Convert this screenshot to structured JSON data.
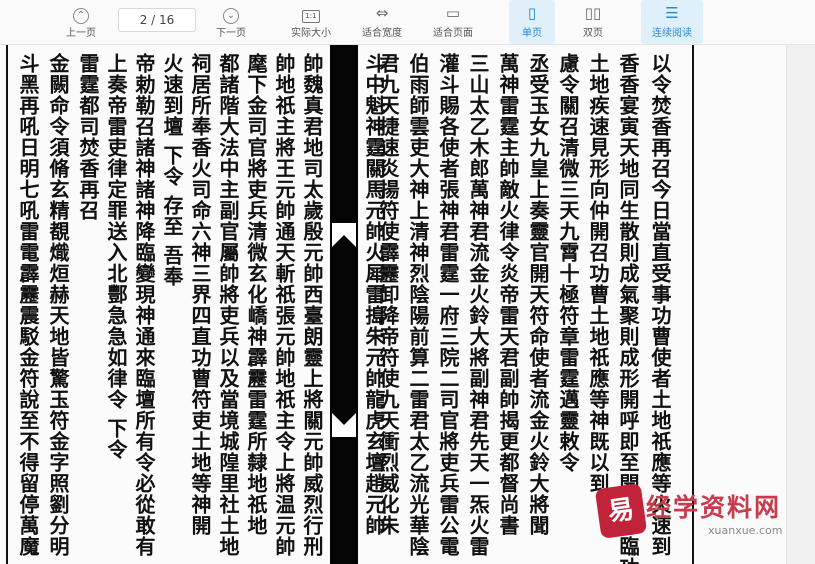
{
  "toolbar": {
    "prev_page": "上一页",
    "page_indicator": "2 / 16",
    "next_page": "下一页",
    "actual_size": "实际大小",
    "actual_size_icon_text": "1:1",
    "fit_width": "适合宽度",
    "fit_page": "适合页面",
    "single_page": "单页",
    "double_page": "双页",
    "continuous": "连续阅读"
  },
  "document": {
    "columns": [
      "以令焚香再召今日當直受事功曹使者土地祇應等火速到",
      "香香宴寅天地同生散則成氣聚則成形開呼即至開召即臨功",
      "土地疾速見形向仲開召功曹土地祇應等神既以到",
      "慮令關召清微三天九霄十極符章雷霆邁靈敕令",
      "丞受玉女九皇上奏靈官開天符命使者流金火鈴大將聞",
      "萬神雷霆主帥敵火律令炎帝雷天君副帥揭更都督尚書",
      "三山太乙木郎萬神君流金火鈴大將副神君先天一炁火雷",
      "灌斗賜各使者張神君雷霆一府三院二司官將吏兵雷公電",
      "伯雨師雲吏大神上清神烈陰陽前算二雷君太乙流光華陰",
      "君九天捷速炎揚符使霹靂卸降帝符使九天衝烈威化朱",
      "斗中魁神霆關馬元帥火犀雷搗朱元帥龍虎玄壇趙元帥",
      "帥魏真君地司太歲殷元帥西臺朗靈上將關元帥威烈行刑",
      "帥地祇主將王元帥通天斬祇張元帥地祇主令上將温元帥",
      "麾下金司官將吏兵清微玄化嶠神霹靂雷霆所隸地祇地",
      "都諸階大法中主副官屬帥將吏兵以及當境城隍里社土地",
      "祠居所奉香火司命六神三界四直功曹符吏土地等神開",
      "火速到壇 下令 存至 吾奉",
      "帝勅勒召諸神諸神降臨變現神通來臨壇所有令必從敢有",
      "上奏帝雷吏律定罪送入北酆急急如律令 下令",
      "雷霆都司焚香再召",
      "金闕命令須脩玄精覩熾烜赫天地皆驚玉符金字照劉分明",
      "斗黑再吼日明七吼雷電霹靂震駁金符說至不得留停萬魔"
    ]
  },
  "watermark": {
    "logo_char": "易",
    "text": "经学资料网",
    "url": "xuanxue.com"
  }
}
